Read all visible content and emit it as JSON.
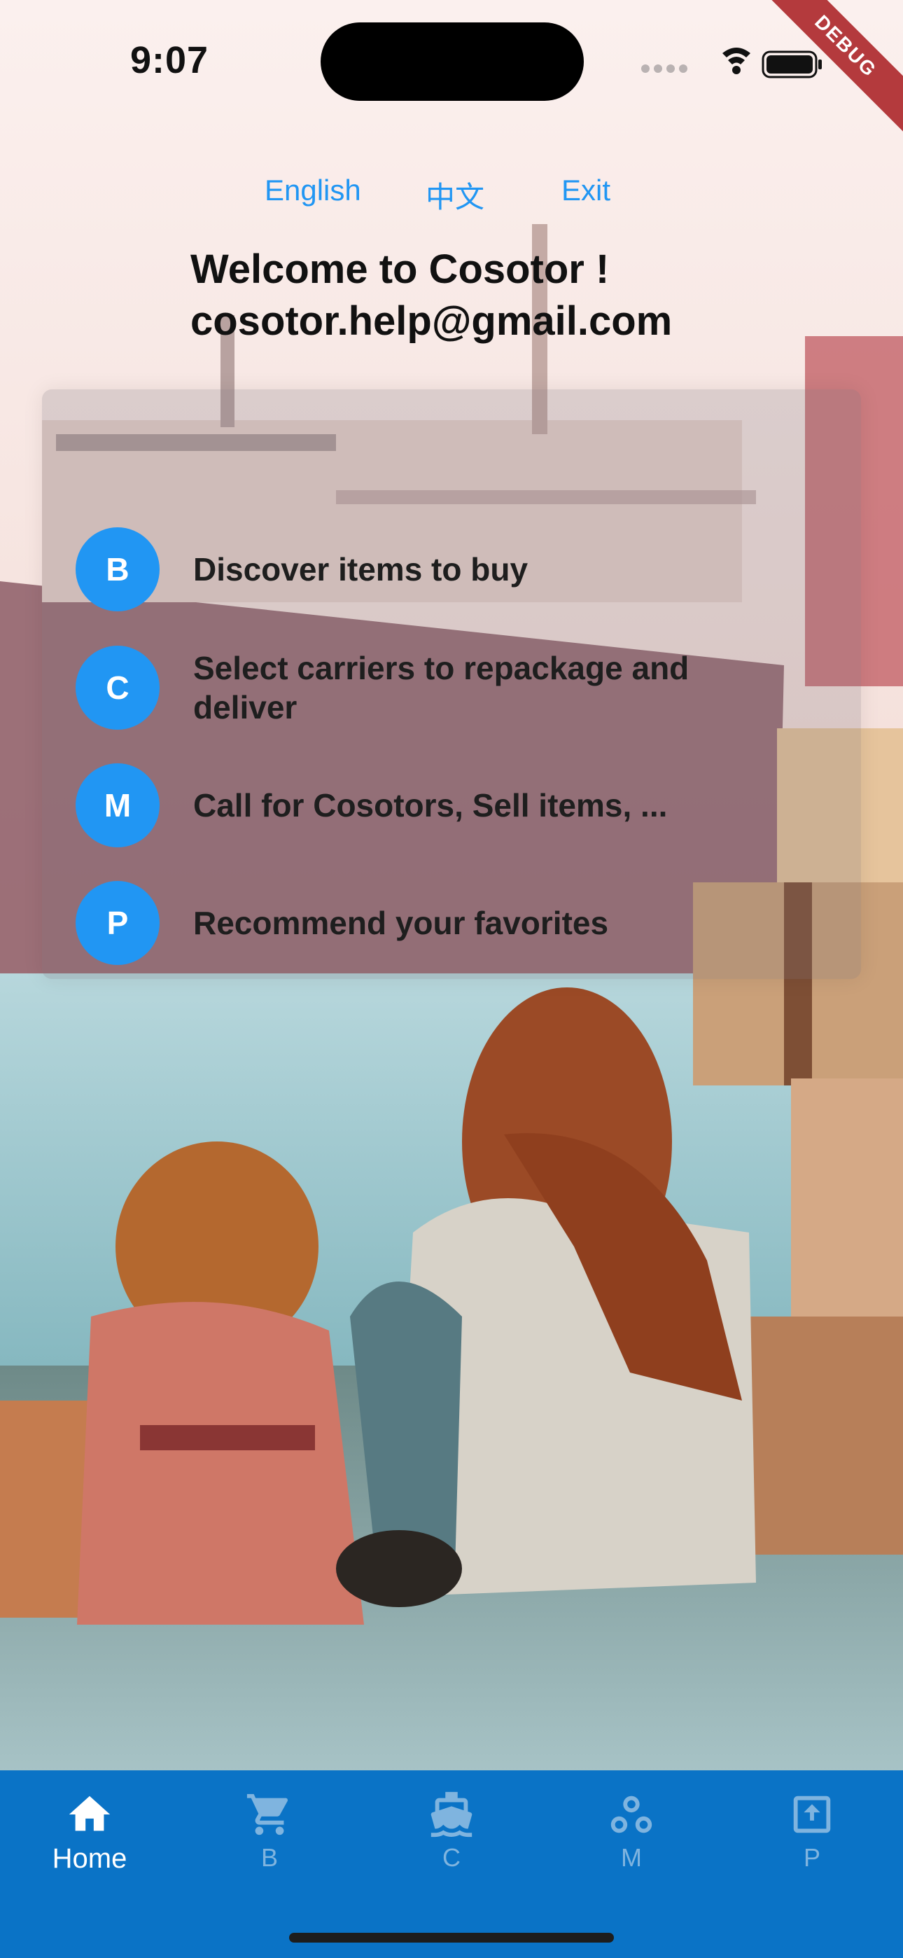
{
  "status_bar": {
    "time": "9:07",
    "debug_label": "DEBUG"
  },
  "language_links": {
    "english": "English",
    "chinese": "中文",
    "exit": "Exit"
  },
  "welcome": {
    "line1": "Welcome to Cosotor !",
    "line2": "cosotor.help@gmail.com"
  },
  "features": [
    {
      "letter": "B",
      "text": "Discover items to buy"
    },
    {
      "letter": "C",
      "text": "Select carriers to repackage and deliver"
    },
    {
      "letter": "M",
      "text": "Call for Cosotors, Sell items, ..."
    },
    {
      "letter": "P",
      "text": "Recommend your favorites"
    }
  ],
  "bottom_nav": {
    "tabs": [
      {
        "label": "Home",
        "icon": "home-icon",
        "active": true
      },
      {
        "label": "B",
        "icon": "shopping-cart-icon",
        "active": false
      },
      {
        "label": "C",
        "icon": "ship-icon",
        "active": false
      },
      {
        "label": "M",
        "icon": "workspaces-icon",
        "active": false
      },
      {
        "label": "P",
        "icon": "upload-box-icon",
        "active": false
      }
    ]
  },
  "colors": {
    "accent": "#2196f3",
    "nav_background": "#0a73c6",
    "nav_inactive": "#7fb4df",
    "debug_ribbon": "#b43a3d"
  }
}
